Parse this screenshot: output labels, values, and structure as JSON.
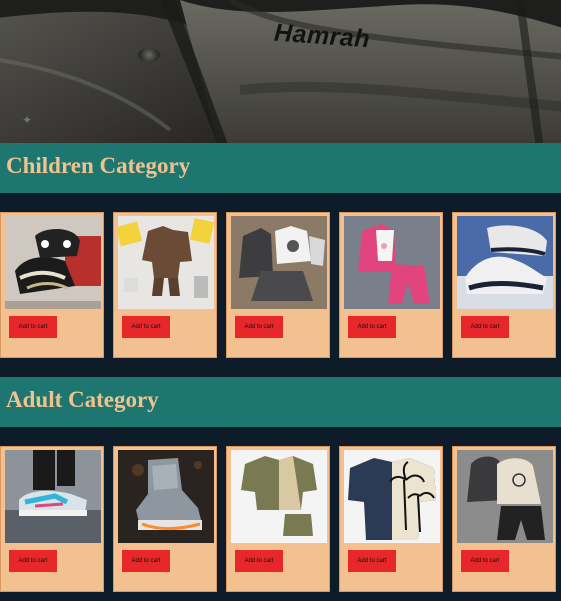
{
  "hero": {
    "brand_text": "Hamrah"
  },
  "categories": [
    {
      "title": "Children Category",
      "products": [
        {
          "name": "kids sneakers",
          "button": "Add to cart"
        },
        {
          "name": "kids fendi shirt set",
          "button": "Add to cart"
        },
        {
          "name": "kids jacket and skirt set",
          "button": "Add to cart"
        },
        {
          "name": "kids pink tracksuit",
          "button": "Add to cart"
        },
        {
          "name": "kids white sneakers",
          "button": "Add to cart"
        }
      ]
    },
    {
      "title": "Adult Category",
      "products": [
        {
          "name": "adult sneakers",
          "button": "Add to cart"
        },
        {
          "name": "adult high-top sneakers",
          "button": "Add to cart"
        },
        {
          "name": "adult shirt and shorts set",
          "button": "Add to cart"
        },
        {
          "name": "adult palm print shirt",
          "button": "Add to cart"
        },
        {
          "name": "adult hoodie set",
          "button": "Add to cart"
        }
      ]
    }
  ],
  "colors": {
    "page_background": "#0e1c2a",
    "category_bar": "#1d7770",
    "category_title": "#f2c28c",
    "card_background": "#f3c18f",
    "add_to_cart_button": "#e8272a"
  }
}
